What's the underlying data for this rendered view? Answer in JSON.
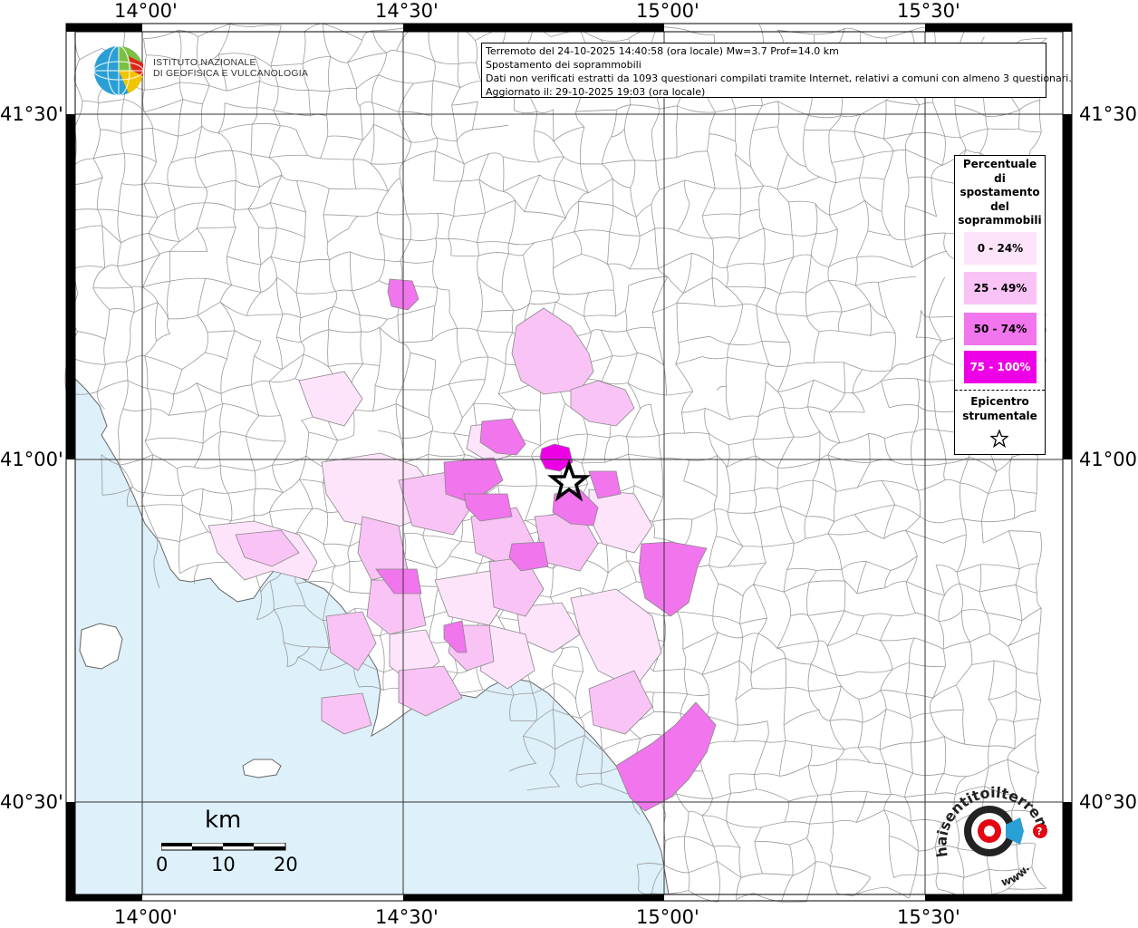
{
  "info": {
    "line1": "Terremoto del 24-10-2025 14:40:58 (ora locale) Mw=3.7 Prof=14.0 km",
    "line2": "Spostamento dei soprammobili",
    "line3": "Dati non verificati estratti da 1093 questionari compilati tramite Internet, relativi a comuni con almeno 3 questionari.",
    "line4": "Aggiornato il: 29-10-2025 19:03 (ora locale)"
  },
  "ingv": {
    "line1": "ISTITUTO NAZIONALE",
    "line2": "DI GEOFISICA E VULCANOLOGIA"
  },
  "legend": {
    "title": [
      "Percentuale",
      "di",
      "spostamento",
      "del",
      "soprammobili"
    ],
    "classes": [
      {
        "label": "0 - 24%",
        "color": "#fde4fa",
        "text_color": "#000000"
      },
      {
        "label": "25 - 49%",
        "color": "#f9c3f5",
        "text_color": "#000000"
      },
      {
        "label": "50 - 74%",
        "color": "#f175ec",
        "text_color": "#000000"
      },
      {
        "label": "75 - 100%",
        "color": "#ee00e6",
        "text_color": "#ffffff"
      }
    ],
    "epicenter_line1": "Epicentro",
    "epicenter_line2": "strumentale",
    "epicenter_icon": "star-icon"
  },
  "axes": {
    "top_labels": [
      "14°00'",
      "14°30'",
      "15°00'",
      "15°30'"
    ],
    "bottom_labels": [
      "14°00'",
      "14°30'",
      "15°00'",
      "15°30'"
    ],
    "left_labels": [
      "41°30'",
      "41°00'",
      "40°30'"
    ],
    "right_labels": [
      "41°30'",
      "41°00'",
      "40°30'"
    ]
  },
  "scale": {
    "unit": "km",
    "labels": [
      "0",
      "10",
      "20"
    ]
  },
  "hai_logo": {
    "text_arc": "haisentitoilterremoto.it",
    "text_www": "www.",
    "icon": "seismic-target-icon"
  },
  "colors": {
    "sea": "#def0fa",
    "land": "#ffffff",
    "border": "#999999"
  }
}
